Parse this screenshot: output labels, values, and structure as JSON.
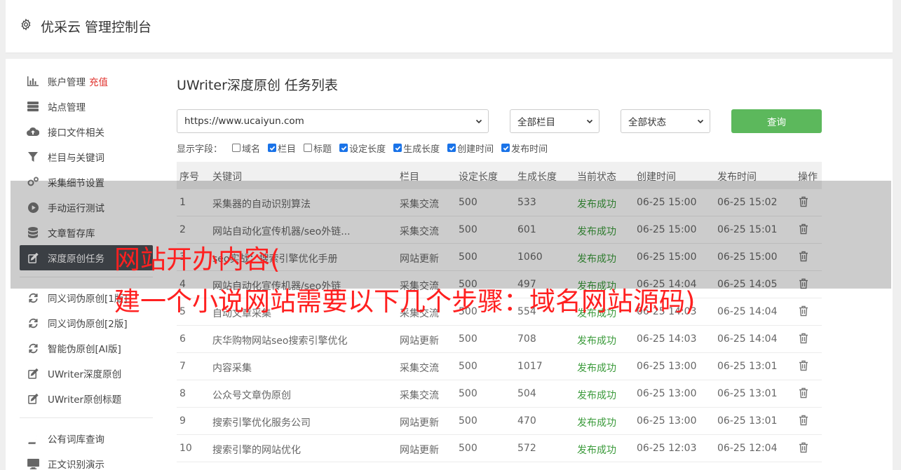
{
  "header": {
    "title": "优采云 管理控制台"
  },
  "sidebar": {
    "items": [
      {
        "label": "账户管理",
        "extra": "充值",
        "icon": "bar-chart-icon"
      },
      {
        "label": "站点管理",
        "icon": "server-icon"
      },
      {
        "label": "接口文件相关",
        "icon": "cloud-upload-icon"
      },
      {
        "label": "栏目与关键词",
        "icon": "filter-icon"
      },
      {
        "label": "采集细节设置",
        "icon": "cogs-icon"
      },
      {
        "label": "手动运行测试",
        "icon": "play-circle-icon"
      },
      {
        "label": "文章暂存库",
        "icon": "database-icon"
      },
      {
        "label": "深度原创任务",
        "icon": "edit-icon",
        "active": true
      },
      {
        "label": "同义词伪原创[1版]",
        "icon": "refresh-icon"
      },
      {
        "label": "同义词伪原创[2版]",
        "icon": "refresh-icon"
      },
      {
        "label": "智能伪原创[AI版]",
        "icon": "refresh-icon"
      },
      {
        "label": "UWriter深度原创",
        "icon": "edit-icon"
      },
      {
        "label": "UWriter原创标题",
        "icon": "edit-icon"
      },
      {
        "label": "公有词库查询",
        "icon": "book-icon"
      },
      {
        "label": "正文识别演示",
        "icon": "monitor-icon"
      }
    ]
  },
  "main": {
    "title": "UWriter深度原创 任务列表",
    "site_select": "https://www.ucaiyun.com",
    "column_select": "全部栏目",
    "status_select": "全部状态",
    "query_button": "查询",
    "fields_label": "显示字段：",
    "fields": [
      {
        "label": "域名",
        "checked": false
      },
      {
        "label": "栏目",
        "checked": true
      },
      {
        "label": "标题",
        "checked": false
      },
      {
        "label": "设定长度",
        "checked": true
      },
      {
        "label": "生成长度",
        "checked": true
      },
      {
        "label": "创建时间",
        "checked": true
      },
      {
        "label": "发布时间",
        "checked": true
      }
    ],
    "table": {
      "headers": [
        "序号",
        "关键词",
        "栏目",
        "设定长度",
        "生成长度",
        "当前状态",
        "创建时间",
        "发布时间",
        "操作"
      ],
      "rows": [
        [
          "1",
          "采集器的自动识别算法",
          "采集交流",
          "500",
          "533",
          "发布成功",
          "06-25 15:00",
          "06-25 15:02"
        ],
        [
          "2",
          "网站自动化宣传机器/seo外链...",
          "采集交流",
          "500",
          "601",
          "发布成功",
          "06-25 15:00",
          "06-25 15:01"
        ],
        [
          "3",
          "seo实战：搜索引擎优化手册",
          "网站更新",
          "500",
          "1060",
          "发布成功",
          "06-25 15:00",
          "06-25 15:00"
        ],
        [
          "4",
          "网站自动化宣传机器/seo外链",
          "采集交流",
          "500",
          "497",
          "发布成功",
          "06-25 14:04",
          "06-25 14:05"
        ],
        [
          "5",
          "自动文章采集",
          "采集交流",
          "500",
          "554",
          "发布成功",
          "06-25 14:03",
          "06-25 14:04"
        ],
        [
          "6",
          "庆华购物网站seo搜索引擎优化",
          "网站更新",
          "500",
          "708",
          "发布成功",
          "06-25 14:03",
          "06-25 14:04"
        ],
        [
          "7",
          "内容采集",
          "采集交流",
          "500",
          "1017",
          "发布成功",
          "06-25 13:00",
          "06-25 13:01"
        ],
        [
          "8",
          "公众号文章伪原创",
          "采集交流",
          "500",
          "504",
          "发布成功",
          "06-25 13:00",
          "06-25 13:01"
        ],
        [
          "9",
          "搜索引擎优化服务公司",
          "网站更新",
          "500",
          "470",
          "发布成功",
          "06-25 13:00",
          "06-25 13:01"
        ],
        [
          "10",
          "搜索引擎的网站优化",
          "网站更新",
          "500",
          "572",
          "发布成功",
          "06-25 12:03",
          "06-25 12:04"
        ]
      ]
    }
  },
  "overlay": {
    "line1": "网站开办内容(",
    "line2": "建一个小说网站需要以下几个步骤：域名网站源码)"
  },
  "colors": {
    "accent_green": "#5cb85c",
    "status_green": "#3a9a3a",
    "recharge_red": "#e0302b",
    "overlay_red": "#ff2020",
    "active_nav": "#4a4f56"
  }
}
